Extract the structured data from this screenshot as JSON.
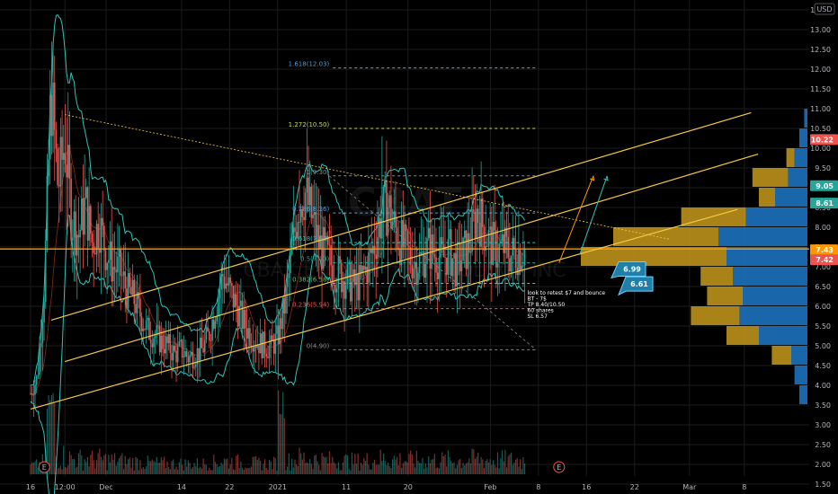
{
  "currency": "USD",
  "watermark": "CBAT",
  "watermark_sub": "CBAK ENERGY TECHNOLOGY INC",
  "colors": {
    "background": "#000000",
    "bull": "#26a69a",
    "bear": "#ef5350",
    "channel": "#f5c842",
    "horizontal": "#ff9800",
    "bollinger": "#2ec4b6",
    "fib": "#5b9bd5",
    "fib_red": "#ef5350",
    "vp_up": "#1e78c8",
    "vp_down": "#c79a1b",
    "grid": "#1b1b1b"
  },
  "y_axis": {
    "min": 1.25,
    "max": 13.75,
    "ticks": [
      "1.50",
      "2.00",
      "2.50",
      "3.00",
      "3.50",
      "4.00",
      "4.50",
      "5.00",
      "5.50",
      "6.00",
      "6.50",
      "7.00",
      "7.50",
      "8.00",
      "8.50",
      "9.00",
      "9.50",
      "10.00",
      "10.50",
      "11.00",
      "11.50",
      "12.00",
      "12.50",
      "13.00",
      "13.50"
    ]
  },
  "x_axis": {
    "labels": [
      {
        "label": "16",
        "day": 0
      },
      {
        "label": "12:00",
        "day": 5
      },
      {
        "label": "Dec",
        "day": 11
      },
      {
        "label": "14",
        "day": 22
      },
      {
        "label": "22",
        "day": 29
      },
      {
        "label": "2021",
        "day": 36
      },
      {
        "label": "11",
        "day": 46
      },
      {
        "label": "20",
        "day": 55
      },
      {
        "label": "Feb",
        "day": 67
      },
      {
        "label": "8",
        "day": 74
      },
      {
        "label": "16",
        "day": 81
      },
      {
        "label": "22",
        "day": 88
      },
      {
        "label": "Mar",
        "day": 96
      },
      {
        "label": "8",
        "day": 104
      }
    ],
    "last_day": 109
  },
  "price_tags": [
    {
      "value": 10.22,
      "label": "10.22",
      "color": "#ef5350"
    },
    {
      "value": 9.05,
      "label": "9.05",
      "color": "#26a69a"
    },
    {
      "value": 8.61,
      "label": "8.61",
      "color": "#26a69a"
    },
    {
      "value": 7.43,
      "label": "7.43",
      "color": "#ff9800"
    },
    {
      "value": 7.42,
      "label": "7.42",
      "color": "#ef5350"
    }
  ],
  "fib_levels": [
    {
      "label": "1.618(12.03)",
      "value": 12.03,
      "color": "#5b9bd5"
    },
    {
      "label": "1.272(10.50)",
      "value": 10.5,
      "color": "#c6d96a"
    },
    {
      "label": "1(9.30)",
      "value": 9.3,
      "color": "#8a8a8a"
    },
    {
      "label": "0.786(8.36)",
      "value": 8.36,
      "color": "#5b9bd5"
    },
    {
      "label": "0.618(7.61)",
      "value": 7.61,
      "color": "#2ec4b6"
    },
    {
      "label": "0.5(7.10)",
      "value": 7.1,
      "color": "#26a69a"
    },
    {
      "label": "0.382(6.58)",
      "value": 6.58,
      "color": "#6fbf73"
    },
    {
      "label": "0.236(5.94)",
      "value": 5.94,
      "color": "#ef5350"
    },
    {
      "label": "0(4.90)",
      "value": 4.9,
      "color": "#8a8a8a"
    }
  ],
  "fib_range": {
    "start_day": 43,
    "end_day": 72
  },
  "horizontal_line": {
    "value": 7.45
  },
  "channel_lines": [
    {
      "from": {
        "day": 0,
        "price": 3.4
      },
      "to": {
        "day": 103,
        "price": 8.45
      }
    },
    {
      "from": {
        "day": 5,
        "price": 4.6
      },
      "to": {
        "day": 106,
        "price": 9.85
      }
    },
    {
      "from": {
        "day": 3,
        "price": 5.65
      },
      "to": {
        "day": 105,
        "price": 10.9
      }
    }
  ],
  "trend_line": {
    "from": {
      "day": 5,
      "price": 10.85
    },
    "to": {
      "day": 93,
      "price": 7.7
    }
  },
  "projections": [
    {
      "points": [
        {
          "day": 77,
          "price": 7.1
        },
        {
          "day": 82,
          "price": 9.3
        }
      ]
    },
    {
      "points": [
        {
          "day": 80,
          "price": 7.3
        },
        {
          "day": 84,
          "price": 9.3
        }
      ]
    }
  ],
  "callouts": [
    {
      "label": "6.99",
      "value": 6.99
    },
    {
      "label": "6.61",
      "value": 6.61
    }
  ],
  "note": {
    "lines": [
      "look to retest $7 and bounce",
      "BT - 7$",
      "TP 8.40/10.50",
      "60 shares",
      "SL 6.57"
    ],
    "day": 75,
    "price": 6.3
  },
  "earnings_markers": [
    {
      "label": "E",
      "day": 2
    },
    {
      "label": "E",
      "day": 77
    }
  ],
  "chart_data": {
    "type": "candlestick",
    "symbol": "CBAT",
    "x_unit": "trading days from first bar",
    "y_unit": "USD",
    "ylim": [
      1.25,
      13.75
    ],
    "approximate_close_path": [
      [
        0,
        3.8
      ],
      [
        1,
        4.2
      ],
      [
        2,
        6.5
      ],
      [
        3,
        11.5
      ],
      [
        4,
        9.0
      ],
      [
        5,
        10.2
      ],
      [
        6,
        8.2
      ],
      [
        7,
        7.8
      ],
      [
        8,
        8.6
      ],
      [
        9,
        7.6
      ],
      [
        10,
        8.1
      ],
      [
        11,
        7.4
      ],
      [
        12,
        7.0
      ],
      [
        13,
        6.9
      ],
      [
        14,
        6.4
      ],
      [
        15,
        6.2
      ],
      [
        16,
        5.8
      ],
      [
        17,
        5.4
      ],
      [
        18,
        5.3
      ],
      [
        19,
        5.1
      ],
      [
        20,
        5.0
      ],
      [
        21,
        4.8
      ],
      [
        22,
        4.9
      ],
      [
        23,
        4.7
      ],
      [
        24,
        4.8
      ],
      [
        25,
        4.9
      ],
      [
        26,
        5.3
      ],
      [
        27,
        6.0
      ],
      [
        28,
        6.8
      ],
      [
        29,
        6.4
      ],
      [
        30,
        6.0
      ],
      [
        31,
        5.6
      ],
      [
        32,
        5.3
      ],
      [
        33,
        5.1
      ],
      [
        34,
        5.0
      ],
      [
        35,
        4.95
      ],
      [
        36,
        5.2
      ],
      [
        37,
        6.0
      ],
      [
        38,
        7.2
      ],
      [
        39,
        8.6
      ],
      [
        40,
        8.9
      ],
      [
        41,
        8.2
      ],
      [
        42,
        7.6
      ],
      [
        43,
        7.3
      ],
      [
        44,
        7.0
      ],
      [
        45,
        6.8
      ],
      [
        46,
        6.7
      ],
      [
        47,
        6.5
      ],
      [
        48,
        6.6
      ],
      [
        49,
        7.0
      ],
      [
        50,
        7.5
      ],
      [
        51,
        8.2
      ],
      [
        52,
        8.6
      ],
      [
        53,
        8.0
      ],
      [
        54,
        7.6
      ],
      [
        55,
        7.3
      ],
      [
        56,
        7.1
      ],
      [
        57,
        7.2
      ],
      [
        58,
        7.5
      ],
      [
        59,
        7.3
      ],
      [
        60,
        7.2
      ],
      [
        61,
        7.4
      ],
      [
        62,
        7.0
      ],
      [
        63,
        7.3
      ],
      [
        64,
        7.6
      ],
      [
        65,
        8.4
      ],
      [
        66,
        8.0
      ],
      [
        67,
        7.6
      ],
      [
        68,
        7.4
      ],
      [
        69,
        7.5
      ],
      [
        70,
        7.3
      ],
      [
        71,
        7.4
      ],
      [
        72,
        7.43
      ]
    ],
    "volume_profile": [
      {
        "price": 3.75,
        "up": 0.05,
        "down": 0.0
      },
      {
        "price": 4.25,
        "up": 0.08,
        "down": 0.0
      },
      {
        "price": 4.75,
        "up": 0.1,
        "down": 0.12
      },
      {
        "price": 5.25,
        "up": 0.3,
        "down": 0.2
      },
      {
        "price": 5.75,
        "up": 0.42,
        "down": 0.3
      },
      {
        "price": 6.25,
        "up": 0.4,
        "down": 0.22
      },
      {
        "price": 6.75,
        "up": 0.46,
        "down": 0.2
      },
      {
        "price": 7.25,
        "up": 0.5,
        "down": 0.9
      },
      {
        "price": 7.75,
        "up": 0.55,
        "down": 0.65
      },
      {
        "price": 8.25,
        "up": 0.38,
        "down": 0.4
      },
      {
        "price": 8.75,
        "up": 0.2,
        "down": 0.1
      },
      {
        "price": 9.25,
        "up": 0.12,
        "down": 0.22
      },
      {
        "price": 9.75,
        "up": 0.08,
        "down": 0.05
      },
      {
        "price": 10.25,
        "up": 0.05,
        "down": 0.0
      },
      {
        "price": 10.75,
        "up": 0.02,
        "down": 0.0
      }
    ]
  }
}
